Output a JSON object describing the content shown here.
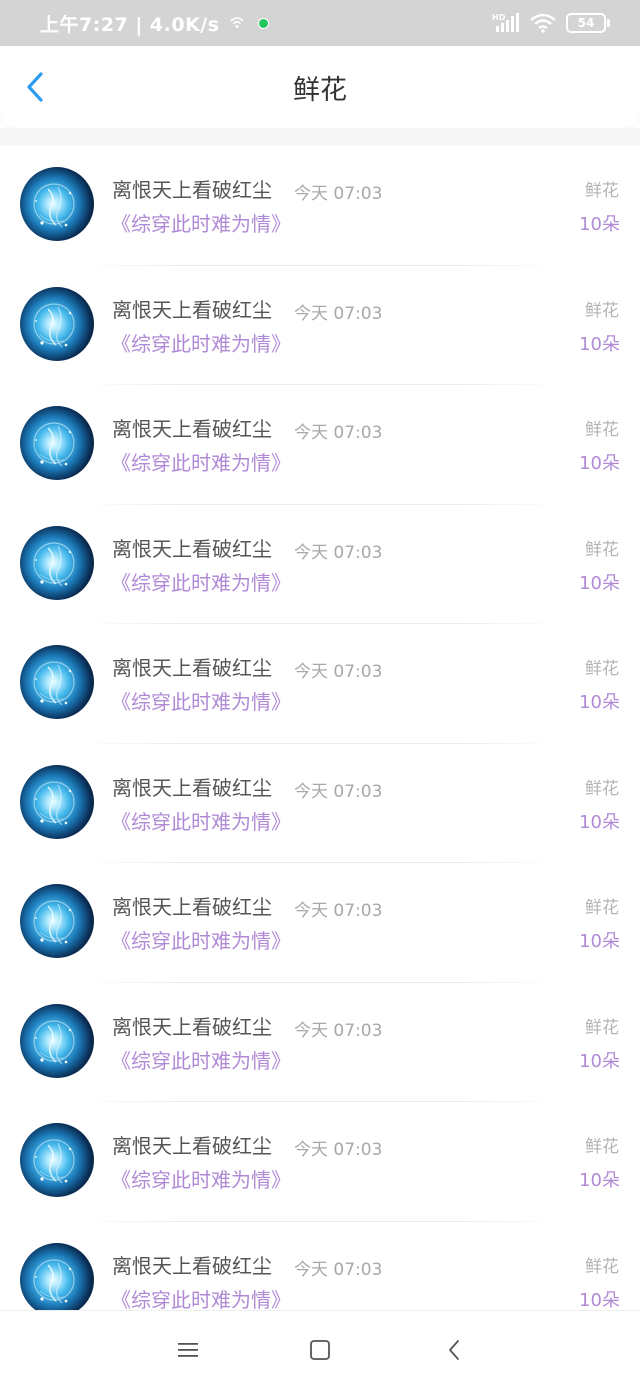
{
  "status_bar": {
    "time_speed": "上午7:27 | 4.0K/s",
    "network_label": "HD",
    "battery": "54"
  },
  "header": {
    "title": "鲜花"
  },
  "colors": {
    "accent": "#2d9cf0",
    "book_title": "#b18ad6",
    "status_bar_bg": "#d4d4d4"
  },
  "items": [
    {
      "user": "离恨天上看破红尘",
      "time": "今天 07:03",
      "book": "《综穿此时难为情》",
      "gift": "鲜花",
      "count": "10朵"
    },
    {
      "user": "离恨天上看破红尘",
      "time": "今天 07:03",
      "book": "《综穿此时难为情》",
      "gift": "鲜花",
      "count": "10朵"
    },
    {
      "user": "离恨天上看破红尘",
      "time": "今天 07:03",
      "book": "《综穿此时难为情》",
      "gift": "鲜花",
      "count": "10朵"
    },
    {
      "user": "离恨天上看破红尘",
      "time": "今天 07:03",
      "book": "《综穿此时难为情》",
      "gift": "鲜花",
      "count": "10朵"
    },
    {
      "user": "离恨天上看破红尘",
      "time": "今天 07:03",
      "book": "《综穿此时难为情》",
      "gift": "鲜花",
      "count": "10朵"
    },
    {
      "user": "离恨天上看破红尘",
      "time": "今天 07:03",
      "book": "《综穿此时难为情》",
      "gift": "鲜花",
      "count": "10朵"
    },
    {
      "user": "离恨天上看破红尘",
      "time": "今天 07:03",
      "book": "《综穿此时难为情》",
      "gift": "鲜花",
      "count": "10朵"
    },
    {
      "user": "离恨天上看破红尘",
      "time": "今天 07:03",
      "book": "《综穿此时难为情》",
      "gift": "鲜花",
      "count": "10朵"
    },
    {
      "user": "离恨天上看破红尘",
      "time": "今天 07:03",
      "book": "《综穿此时难为情》",
      "gift": "鲜花",
      "count": "10朵"
    },
    {
      "user": "离恨天上看破红尘",
      "time": "今天 07:03",
      "book": "《综穿此时难为情》",
      "gift": "鲜花",
      "count": "10朵"
    }
  ],
  "nav": {
    "icons": [
      "menu-icon",
      "home-square-icon",
      "back-chevron-icon"
    ]
  }
}
